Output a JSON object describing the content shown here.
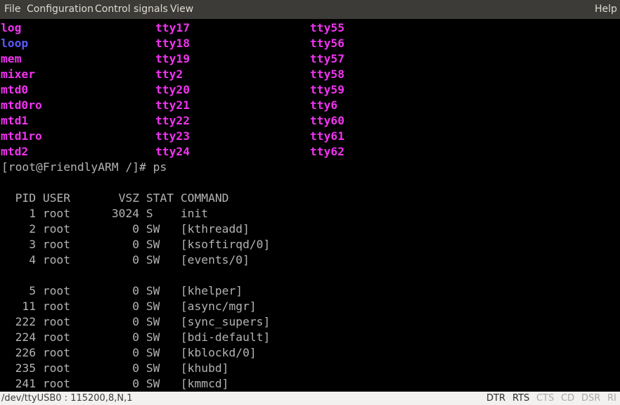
{
  "menu": {
    "file": "File",
    "configuration": "Configuration",
    "control_signals": "Control signals",
    "view": "View",
    "help": "Help"
  },
  "colors": {
    "device_magenta": "#f033f0",
    "device_blue": "#5a5aff",
    "text_gray": "#b3b3b3",
    "menubar_bg": "#3c3b37"
  },
  "ls_columns": [
    [
      {
        "name": "log",
        "color": "magenta"
      },
      {
        "name": "loop",
        "color": "blue"
      },
      {
        "name": "mem",
        "color": "magenta"
      },
      {
        "name": "mixer",
        "color": "magenta"
      },
      {
        "name": "mtd0",
        "color": "magenta"
      },
      {
        "name": "mtd0ro",
        "color": "magenta"
      },
      {
        "name": "mtd1",
        "color": "magenta"
      },
      {
        "name": "mtd1ro",
        "color": "magenta"
      },
      {
        "name": "mtd2",
        "color": "magenta"
      }
    ],
    [
      {
        "name": "tty17",
        "color": "magenta"
      },
      {
        "name": "tty18",
        "color": "magenta"
      },
      {
        "name": "tty19",
        "color": "magenta"
      },
      {
        "name": "tty2",
        "color": "magenta"
      },
      {
        "name": "tty20",
        "color": "magenta"
      },
      {
        "name": "tty21",
        "color": "magenta"
      },
      {
        "name": "tty22",
        "color": "magenta"
      },
      {
        "name": "tty23",
        "color": "magenta"
      },
      {
        "name": "tty24",
        "color": "magenta"
      }
    ],
    [
      {
        "name": "tty55",
        "color": "magenta"
      },
      {
        "name": "tty56",
        "color": "magenta"
      },
      {
        "name": "tty57",
        "color": "magenta"
      },
      {
        "name": "tty58",
        "color": "magenta"
      },
      {
        "name": "tty59",
        "color": "magenta"
      },
      {
        "name": "tty6",
        "color": "magenta"
      },
      {
        "name": "tty60",
        "color": "magenta"
      },
      {
        "name": "tty61",
        "color": "magenta"
      },
      {
        "name": "tty62",
        "color": "magenta"
      }
    ]
  ],
  "prompt_line": "[root@FriendlyARM /]# ps",
  "ps_lines": [
    "",
    "  PID USER       VSZ STAT COMMAND",
    "    1 root      3024 S    init",
    "    2 root         0 SW   [kthreadd]",
    "    3 root         0 SW   [ksoftirqd/0]",
    "    4 root         0 SW   [events/0]",
    "",
    "    5 root         0 SW   [khelper]",
    "   11 root         0 SW   [async/mgr]",
    "  222 root         0 SW   [sync_supers]",
    "  224 root         0 SW   [bdi-default]",
    "  226 root         0 SW   [kblockd/0]",
    "  235 root         0 SW   [khubd]",
    "  241 root         0 SW   [kmmcd]"
  ],
  "status": {
    "port": "/dev/ttyUSB0 : 115200,8,N,1",
    "signals": [
      {
        "label": "DTR",
        "active": true
      },
      {
        "label": "RTS",
        "active": true
      },
      {
        "label": "CTS",
        "active": false
      },
      {
        "label": "CD",
        "active": false
      },
      {
        "label": "DSR",
        "active": false
      },
      {
        "label": "RI",
        "active": false
      }
    ]
  }
}
